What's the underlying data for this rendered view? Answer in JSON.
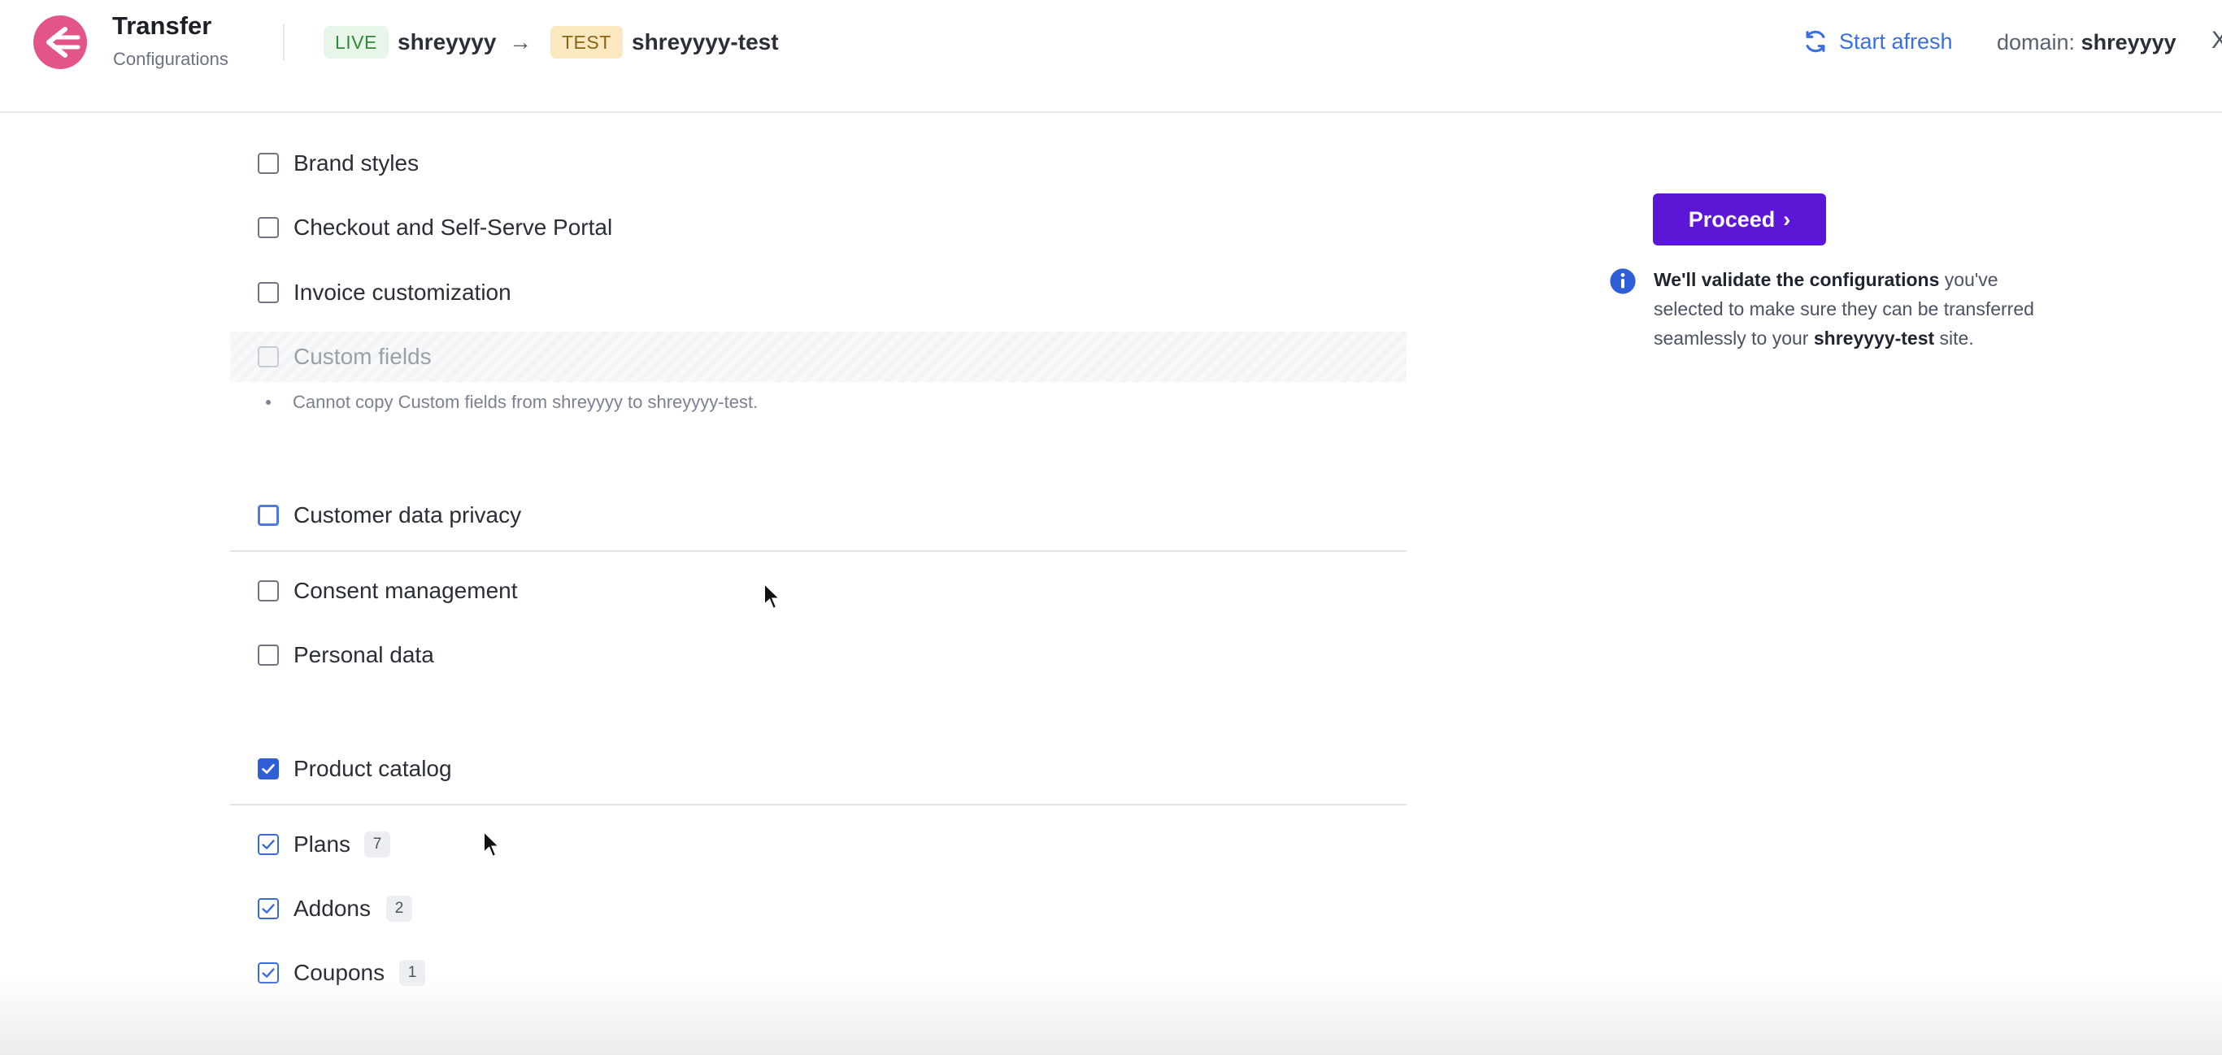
{
  "header": {
    "title": "Transfer",
    "subtitle": "Configurations",
    "live_tag": "LIVE",
    "live_site": "shreyyyy",
    "arrow": "→",
    "test_tag": "TEST",
    "test_site": "shreyyyy-test",
    "start_afresh": "Start afresh",
    "domain_label": "domain:",
    "domain_value": "shreyyyy",
    "close_glyph": "X"
  },
  "icons": {
    "logo": "transfer-logo-icon",
    "refresh": "refresh-icon",
    "arrow": "arrow-right-icon",
    "info": "info-icon",
    "check": "check-icon",
    "chevron": "chevron-right-icon"
  },
  "items": {
    "brand_styles": "Brand styles",
    "checkout": "Checkout and Self-Serve Portal",
    "invoice": "Invoice customization",
    "custom_fields": "Custom fields",
    "custom_fields_error": "Cannot copy Custom fields from shreyyyy to shreyyyy-test.",
    "customer_privacy": "Customer data privacy",
    "consent": "Consent management",
    "personal_data": "Personal data",
    "product_catalog": "Product catalog",
    "plans": "Plans",
    "plans_count": "7",
    "addons": "Addons",
    "addons_count": "2",
    "coupons": "Coupons",
    "coupons_count": "1"
  },
  "panel": {
    "proceed": "Proceed",
    "chevron": "›",
    "info_bold_1": "We'll validate the configurations",
    "info_text_1": " you've selected to make sure they can be transferred seamlessly to your ",
    "info_bold_2": "shreyyyy-test",
    "info_text_2": " site."
  },
  "colors": {
    "primary": "#5c17d6",
    "link": "#3b6fe0",
    "checkbox_checked": "#2f5fd6",
    "live_bg": "#e7f6e8",
    "test_bg": "#fbe8c0",
    "logo": "#e3558a"
  }
}
